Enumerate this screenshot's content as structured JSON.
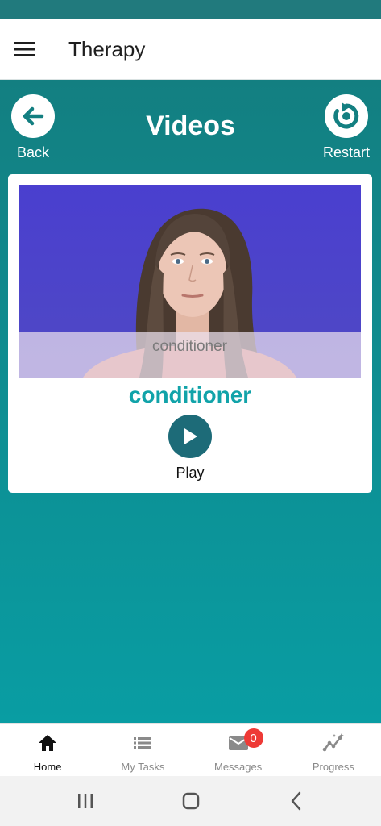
{
  "app_bar": {
    "title": "Therapy",
    "menu_icon": "hamburger-menu-icon"
  },
  "header": {
    "title": "Videos",
    "back_label": "Back",
    "restart_label": "Restart"
  },
  "video": {
    "caption": "conditioner",
    "word": "conditioner",
    "play_label": "Play"
  },
  "bottom_nav": {
    "tabs": [
      {
        "label": "Home",
        "icon": "home-icon",
        "active": true
      },
      {
        "label": "My Tasks",
        "icon": "list-icon",
        "active": false
      },
      {
        "label": "Messages",
        "icon": "mail-icon",
        "active": false,
        "badge": "0"
      },
      {
        "label": "Progress",
        "icon": "progress-chart-icon",
        "active": false
      }
    ]
  },
  "colors": {
    "accent": "#11a3a9",
    "status_bar": "#217a7d",
    "badge": "#ee3a36",
    "play_button": "#1d6b78"
  }
}
